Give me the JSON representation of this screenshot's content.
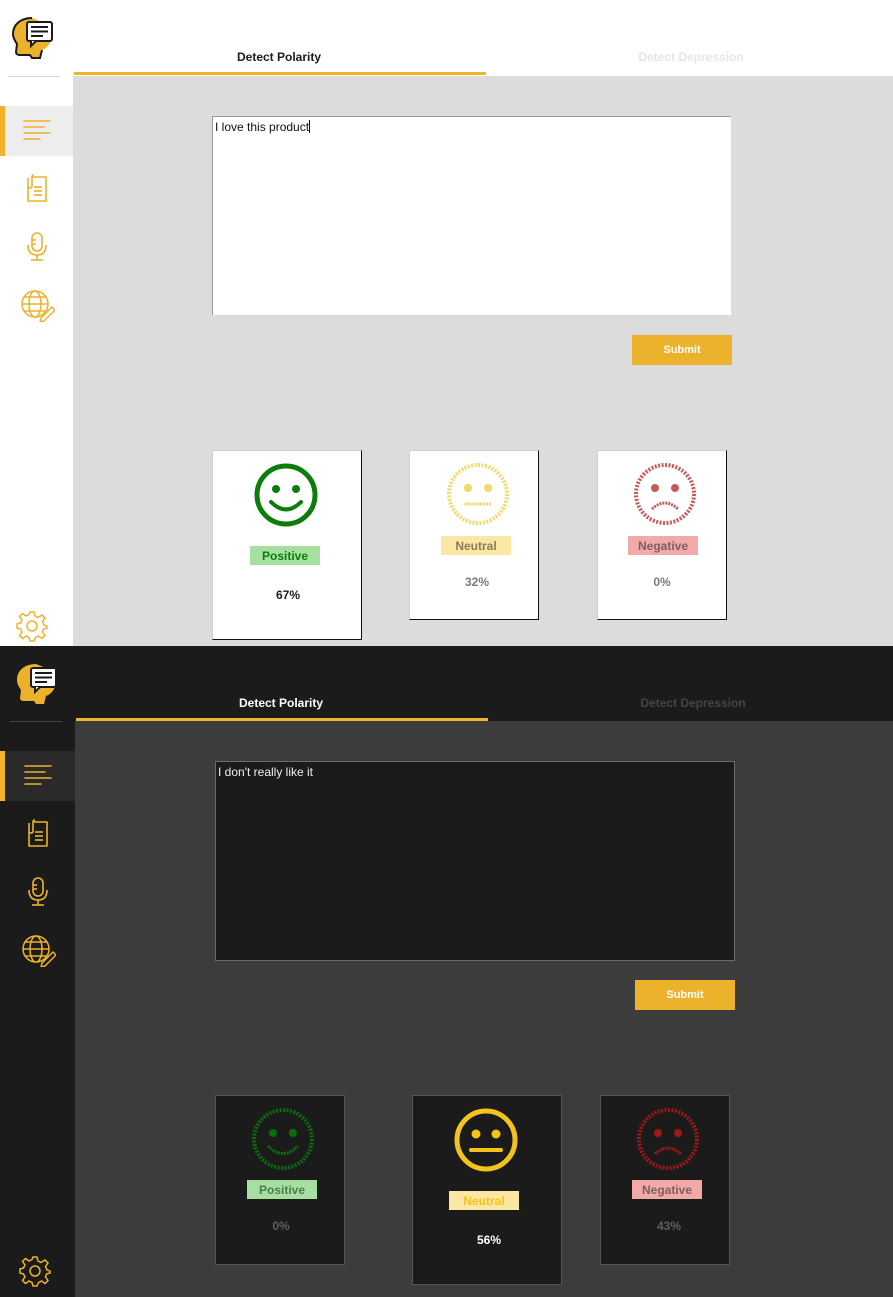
{
  "colors": {
    "accent": "#edb22c",
    "positive_green": "#0a7d0a",
    "neutral_yellow": "#f2c31b",
    "negative_red": "#b11d1d",
    "positive_badge": "#a6e0a0",
    "neutral_badge": "#fbe7a4",
    "negative_badge": "#f4a9a9"
  },
  "light": {
    "tabs": [
      {
        "label": "Detect Polarity",
        "active": true
      },
      {
        "label": "Detect Depression",
        "active": false
      }
    ],
    "sidebar": [
      "text-lines-icon",
      "document-icon",
      "microphone-icon",
      "globe-edit-icon",
      "gear-icon"
    ],
    "input_text": "I love this product",
    "submit_label": "Submit",
    "results": {
      "positive": {
        "label": "Positive",
        "percent": "67%",
        "highlighted": true
      },
      "neutral": {
        "label": "Neutral",
        "percent": "32%",
        "highlighted": false
      },
      "negative": {
        "label": "Negative",
        "percent": "0%",
        "highlighted": false
      }
    }
  },
  "dark": {
    "tabs": [
      {
        "label": "Detect Polarity",
        "active": true
      },
      {
        "label": "Detect Depression",
        "active": false
      }
    ],
    "sidebar": [
      "text-lines-icon",
      "document-icon",
      "microphone-icon",
      "globe-edit-icon",
      "gear-icon"
    ],
    "input_text": "I don't really like it",
    "submit_label": "Submit",
    "results": {
      "positive": {
        "label": "Positive",
        "percent": "0%",
        "highlighted": false
      },
      "neutral": {
        "label": "Neutral",
        "percent": "56%",
        "highlighted": true
      },
      "negative": {
        "label": "Negative",
        "percent": "43%",
        "highlighted": false
      }
    }
  }
}
